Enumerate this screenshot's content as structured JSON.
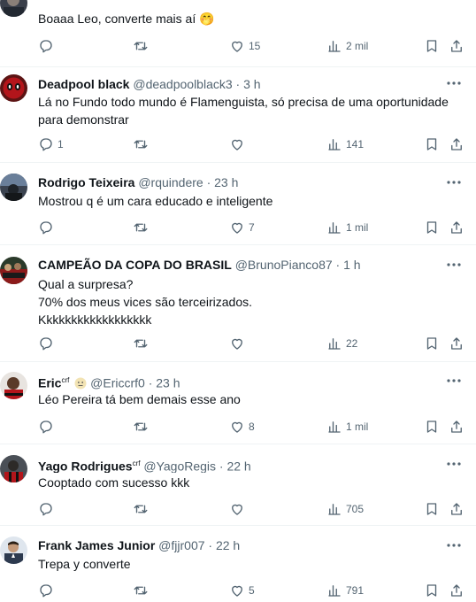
{
  "tweets": [
    {
      "id": "t0",
      "name": "",
      "handle": "",
      "time": "",
      "text": "Boaaa Leo, converte mais aí",
      "emoji": "🤭",
      "replies": "",
      "likes": "15",
      "views": "2 mil"
    },
    {
      "id": "t1",
      "name": "Deadpool black",
      "handle": "@deadpoolblack3 · 3 h",
      "text": "Lá no Fundo todo mundo é Flamenguista, só precisa de uma oportunidade\npara demonstrar",
      "replies": "1",
      "likes": "",
      "views": "141"
    },
    {
      "id": "t2",
      "name": "Rodrigo Teixeira",
      "handle": "@rquindere · 23 h",
      "text": "Mostrou q é um cara educado e inteligente",
      "replies": "",
      "likes": "7",
      "views": "1 mil"
    },
    {
      "id": "t3",
      "name": "CAMPEÃO DA COPA DO BRASIL",
      "handle": "@BrunoPianco87 · 1 h",
      "text": "Qual a surpresa?\n70% dos meus vices são terceirizados.\nKkkkkkkkkkkkkkkkkk",
      "replies": "",
      "likes": "",
      "views": "22"
    },
    {
      "id": "t4",
      "name": "Eric",
      "name_sup": "crf",
      "handle": "@Ericcrf0 · 23 h",
      "text": "Léo Pereira tá bem demais esse ano",
      "replies": "",
      "likes": "8",
      "views": "1 mil"
    },
    {
      "id": "t5",
      "name": "Yago Rodrigues",
      "name_sup": "crf",
      "handle": "@YagoRegis · 22 h",
      "text": "Cooptado com sucesso kkk",
      "replies": "",
      "likes": "",
      "views": "705"
    },
    {
      "id": "t6",
      "name": "Frank James Junior",
      "handle": "@fjjr007 · 22 h",
      "text": "Trepa y converte",
      "replies": "",
      "likes": "5",
      "views": "791"
    }
  ],
  "icons": {
    "reply": "reply-icon",
    "retweet": "retweet-icon",
    "like": "heart-icon",
    "views": "views-icon",
    "bookmark": "bookmark-icon",
    "share": "share-icon",
    "more": "more-icon"
  },
  "colors": {
    "text_primary": "#0f1419",
    "text_secondary": "#536471",
    "divider": "#eff3f4"
  }
}
